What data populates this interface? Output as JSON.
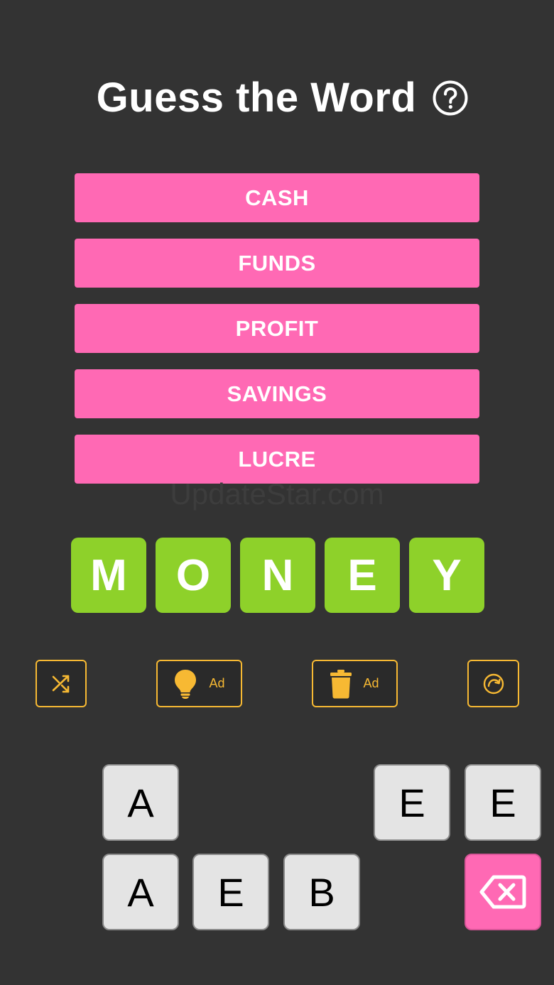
{
  "header": {
    "title": "Guess the Word",
    "help_icon": "question-circle-icon"
  },
  "clues": [
    "CASH",
    "FUNDS",
    "PROFIT",
    "SAVINGS",
    "LUCRE"
  ],
  "watermark": "UpdateStar.com",
  "answer": [
    "M",
    "O",
    "N",
    "E",
    "Y"
  ],
  "tools": {
    "shuffle_icon": "shuffle-icon",
    "hint_icon": "lightbulb-icon",
    "hint_label": "Ad",
    "remove_icon": "trash-icon",
    "remove_label": "Ad",
    "restart_icon": "restart-icon"
  },
  "keyboard": {
    "row1": [
      "A",
      "E",
      "E"
    ],
    "row2": [
      "A",
      "E",
      "B"
    ],
    "delete_icon": "backspace-icon"
  },
  "colors": {
    "background": "#333333",
    "clue_bg": "#ff69b4",
    "answer_bg": "#8ed12a",
    "tool_accent": "#f7b933",
    "key_bg": "#e4e4e4",
    "delete_bg": "#ff69b4"
  }
}
